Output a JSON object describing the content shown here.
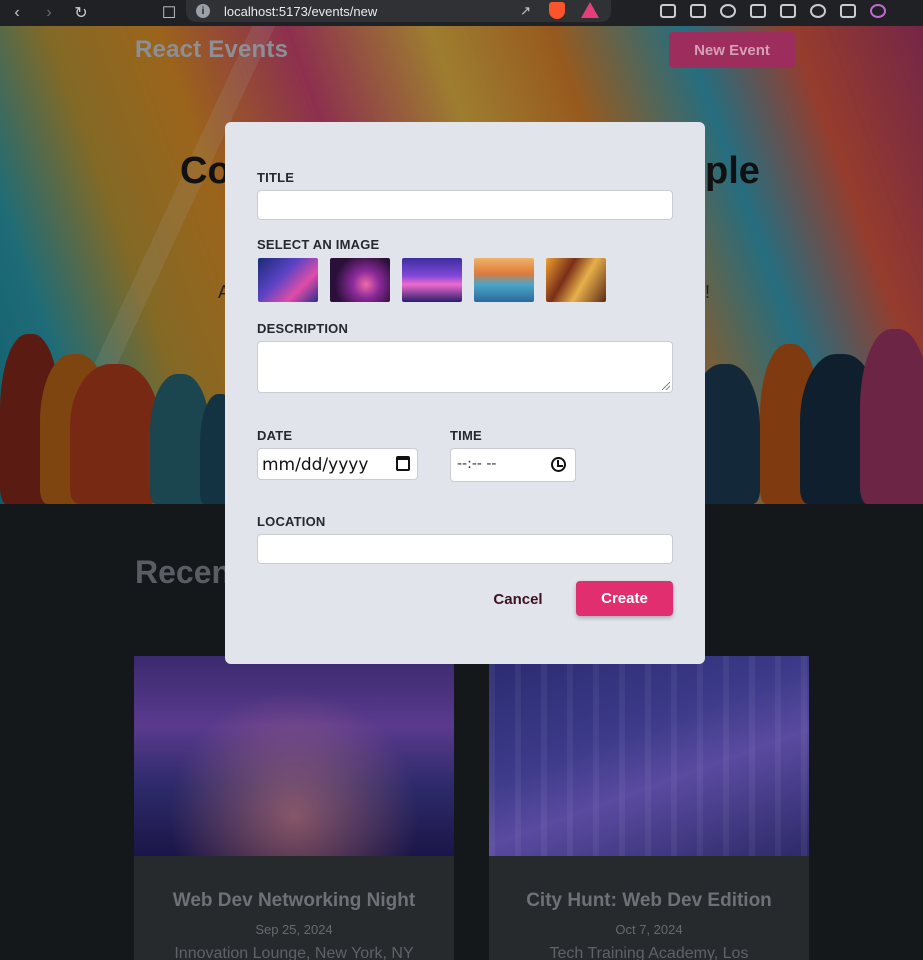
{
  "browser": {
    "url": "localhost:5173/events/new",
    "icons": [
      "back-icon",
      "forward-icon",
      "reload-icon",
      "bookmark-icon",
      "info-icon",
      "share-icon",
      "brave-shield-icon",
      "brave-rewards-icon",
      "extensions-icon",
      "reader-icon",
      "media-icon",
      "sidebar-icon",
      "wallet-icon",
      "leo-icon",
      "vpn-icon",
      "profile-icon"
    ]
  },
  "header": {
    "brand": "React Events",
    "new_event_label": "New Event"
  },
  "hero": {
    "title_left": "Co",
    "title_right": "ple",
    "subtitle_left": "A",
    "subtitle_right": "!"
  },
  "section": {
    "recent_heading": "Recen"
  },
  "cards": [
    {
      "title": "Web Dev Networking Night",
      "date": "Sep 25, 2024",
      "location": "Innovation Lounge, New York, NY"
    },
    {
      "title": "City Hunt: Web Dev Edition",
      "date": "Oct 7, 2024",
      "location": "Tech Training Academy, Los"
    }
  ],
  "form": {
    "title_label": "TITLE",
    "title_value": "",
    "image_label": "SELECT AN IMAGE",
    "images": [
      "city-night-image",
      "stage-lights-image",
      "concert-crowd-image",
      "skyline-river-image",
      "team-laptop-image"
    ],
    "description_label": "DESCRIPTION",
    "description_value": "",
    "date_label": "DATE",
    "date_placeholder": "mm/dd/yyyy",
    "time_label": "TIME",
    "time_placeholder": "--:-- --",
    "location_label": "LOCATION",
    "location_value": "",
    "cancel_label": "Cancel",
    "create_label": "Create"
  },
  "colors": {
    "accent": "#e12e6f",
    "modal_bg": "#e2e4ec",
    "page_bg": "#15181a"
  }
}
